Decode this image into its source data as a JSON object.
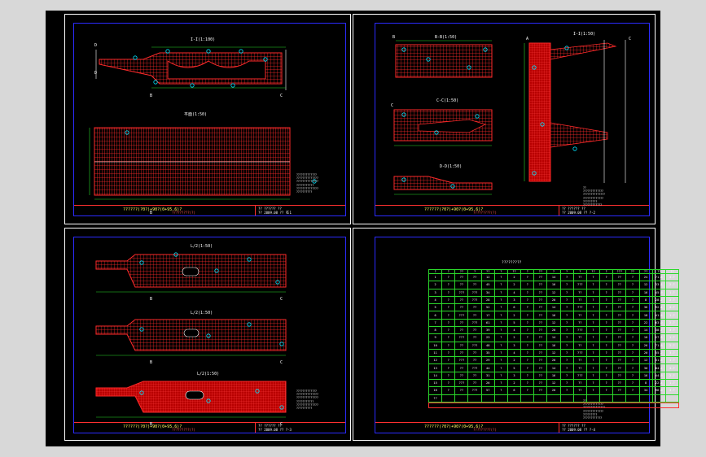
{
  "colors": {
    "background": "#000000",
    "frame": "#ffffff",
    "border": "#2b2bff",
    "rebar": "#ff2a2a",
    "dimension": "#2bd82b",
    "callout": "#00e5ff",
    "text": "#ffffff",
    "title": "#ffff66"
  },
  "sheets": [
    {
      "id": "sheet1",
      "views": [
        {
          "title": "I-I(1:100)"
        },
        {
          "title": "平面(1:50)"
        }
      ],
      "section_marks": [
        "D",
        "D",
        "B",
        "C",
        "B",
        "C"
      ],
      "title_main": "??????(?0?)+90?(0+95.6)?",
      "title_sub": "?????????(?)",
      "title_block_1": "?? ?????? ??",
      "title_block_2": "?? 2009.08 ?? ?-1"
    },
    {
      "id": "sheet2",
      "views": [
        {
          "title": "B-B(1:50)"
        },
        {
          "title": "I-I(1:50)"
        },
        {
          "title": "C-C(1:50)"
        },
        {
          "title": "D-D(1:50)"
        }
      ],
      "section_marks": [
        "B",
        "C",
        "A",
        "C"
      ],
      "title_main": "??????(?0?)+90?(0+95.6)?",
      "title_sub": "?????????(?)",
      "title_block_1": "?? ?????? ??",
      "title_block_2": "?? 2009.08 ?? ?-2"
    },
    {
      "id": "sheet3",
      "views": [
        {
          "title": "L/2(1:50)"
        },
        {
          "title": "L/2(1:50)"
        },
        {
          "title": "L/2(1:50)"
        }
      ],
      "section_marks": [
        "B",
        "C",
        "B",
        "C",
        "B",
        "C"
      ],
      "title_main": "??????(?0?)+90?(0+95.6)?",
      "title_sub": "?????????(?)",
      "title_block_1": "?? ?????? ??",
      "title_block_2": "?? 2009.08 ?? ?-3"
    },
    {
      "id": "sheet4",
      "table_caption": "?????????",
      "table_footer": "?????????",
      "title_main": "??????(?0?)+90?(0+95.6)?",
      "title_sub": "?????????(?)",
      "title_block_1": "?? ?????? ??",
      "title_block_2": "?? 2009.08 ?? ?-4"
    }
  ],
  "bom": {
    "headers": [
      "?",
      "?",
      "??",
      "?",
      "??",
      "?",
      "??",
      "?",
      "??",
      "?",
      "?",
      "?",
      "??",
      "?",
      "???",
      "??",
      "??",
      "??",
      "??"
    ],
    "rows": [
      [
        "1",
        "?",
        "??",
        "??",
        "12",
        "?",
        "2",
        "?",
        "??",
        "14",
        "?",
        "??",
        "?",
        "?",
        "??",
        "?",
        "24",
        "71.6",
        "3.?"
      ],
      [
        "2",
        "?",
        "??",
        "??",
        "45",
        "?",
        "2",
        "?",
        "??",
        "16",
        "?",
        "???",
        "?",
        "?",
        "??",
        "?",
        "12",
        "33.1",
        "2.?"
      ],
      [
        "3",
        "?",
        "???",
        "???",
        "34",
        "?",
        "4",
        "?",
        "??",
        "12",
        "?",
        "??",
        "?",
        "?",
        "??",
        "?",
        "16",
        "45.9",
        "1.?"
      ],
      [
        "4",
        "?",
        "??",
        "???",
        "28",
        "?",
        "3",
        "?",
        "??",
        "20",
        "?",
        "??",
        "?",
        "?",
        "??",
        "?",
        "8",
        "28.2",
        "2.?"
      ],
      [
        "5",
        "?",
        "??",
        "??",
        "52",
        "?",
        "6",
        "?",
        "??",
        "14",
        "?",
        "???",
        "?",
        "?",
        "??",
        "?",
        "36",
        "92.4",
        "4.?"
      ],
      [
        "6",
        "?",
        "???",
        "??",
        "17",
        "?",
        "2",
        "?",
        "??",
        "16",
        "?",
        "??",
        "?",
        "?",
        "??",
        "?",
        "18",
        "41.5",
        "1.?"
      ],
      [
        "7",
        "?",
        "??",
        "???",
        "61",
        "?",
        "5",
        "?",
        "??",
        "12",
        "?",
        "??",
        "?",
        "?",
        "??",
        "?",
        "22",
        "63.0",
        "2.?"
      ],
      [
        "8",
        "?",
        "??",
        "??",
        "39",
        "?",
        "4",
        "?",
        "??",
        "20",
        "?",
        "???",
        "?",
        "?",
        "??",
        "?",
        "14",
        "38.7",
        "3.?"
      ],
      [
        "9",
        "?",
        "???",
        "??",
        "23",
        "?",
        "2",
        "?",
        "??",
        "14",
        "?",
        "??",
        "?",
        "?",
        "??",
        "?",
        "10",
        "27.3",
        "1.?"
      ],
      [
        "10",
        "?",
        "??",
        "???",
        "48",
        "?",
        "3",
        "?",
        "??",
        "16",
        "?",
        "??",
        "?",
        "?",
        "??",
        "?",
        "26",
        "71.8",
        "2.?"
      ],
      [
        "11",
        "?",
        "??",
        "??",
        "35",
        "?",
        "4",
        "?",
        "??",
        "12",
        "?",
        "???",
        "?",
        "?",
        "??",
        "?",
        "20",
        "55.2",
        "3.?"
      ],
      [
        "12",
        "?",
        "???",
        "??",
        "29",
        "?",
        "2",
        "?",
        "??",
        "20",
        "?",
        "??",
        "?",
        "?",
        "??",
        "?",
        "12",
        "31.6",
        "1.?"
      ],
      [
        "13",
        "?",
        "??",
        "???",
        "44",
        "?",
        "5",
        "?",
        "??",
        "14",
        "?",
        "??",
        "?",
        "?",
        "??",
        "?",
        "30",
        "84.1",
        "4.?"
      ],
      [
        "14",
        "?",
        "??",
        "??",
        "31",
        "?",
        "3",
        "?",
        "??",
        "16",
        "?",
        "???",
        "?",
        "?",
        "??",
        "?",
        "16",
        "44.9",
        "2.?"
      ],
      [
        "15",
        "?",
        "???",
        "??",
        "26",
        "?",
        "2",
        "?",
        "??",
        "12",
        "?",
        "??",
        "?",
        "?",
        "??",
        "?",
        "8",
        "22.4",
        "1.?"
      ],
      [
        "16",
        "?",
        "??",
        "???",
        "57",
        "?",
        "6",
        "?",
        "??",
        "20",
        "?",
        "??",
        "?",
        "?",
        "??",
        "?",
        "34",
        "96.0",
        "3.?"
      ],
      [
        "??",
        "",
        "",
        "",
        "",
        "",
        "",
        "",
        "",
        "",
        "",
        "",
        "",
        "",
        "",
        "",
        "",
        "",
        ""
      ]
    ]
  },
  "notes": {
    "sheet1": "?????????????\n??????????????\n??????????????\n???????????\n??????????????\n??????????",
    "sheet2": "??\n?????????????\n??????????????\n?????????????\n?????????\n????????????",
    "sheet3": "?????????????\n??????????????\n??????????????\n???????????\n??????????????\n??????????",
    "sheet4": "??\n?????????????\n??????????????\n?????????????\n?????????\n????????????"
  }
}
